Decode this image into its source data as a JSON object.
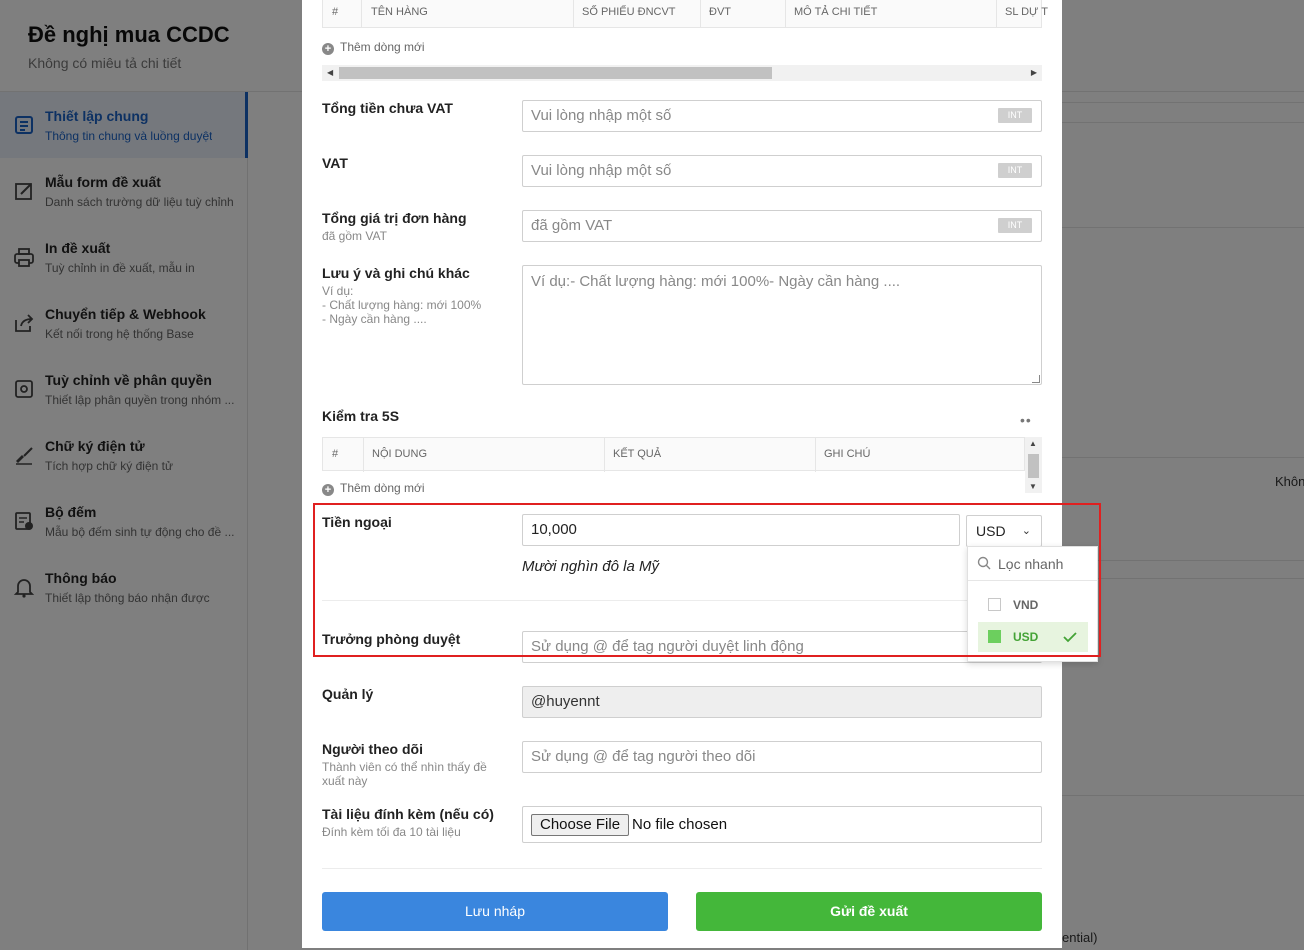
{
  "page": {
    "title": "Đề nghị mua CCDC",
    "subtitle": "Không có miêu tả chi tiết"
  },
  "sidebar": {
    "items": [
      {
        "title": "Thiết lập chung",
        "desc": "Thông tin chung và luồng duyệt",
        "icon": "document-icon",
        "active": true
      },
      {
        "title": "Mẫu form đề xuất",
        "desc": "Danh sách trường dữ liệu tuỳ chỉnh",
        "icon": "edit-icon"
      },
      {
        "title": "In đề xuất",
        "desc": "Tuỳ chỉnh in đề xuất, mẫu in",
        "icon": "printer-icon"
      },
      {
        "title": "Chuyển tiếp & Webhook",
        "desc": "Kết nối trong hệ thống Base",
        "icon": "share-icon"
      },
      {
        "title": "Tuỳ chỉnh về phân quyền",
        "desc": "Thiết lập phân quyền trong nhóm ...",
        "icon": "settings-icon"
      },
      {
        "title": "Chữ ký điện tử",
        "desc": "Tích hợp chữ ký điện tử",
        "icon": "signature-icon"
      },
      {
        "title": "Bộ đếm",
        "desc": "Mẫu bộ đếm sinh tự động cho đề ...",
        "icon": "counter-icon"
      },
      {
        "title": "Thông báo",
        "desc": "Thiết lập thông báo nhận được",
        "icon": "bell-icon"
      }
    ]
  },
  "background": {
    "right_text": "Khôn",
    "bottom_text": "ential)"
  },
  "modal": {
    "items_table": {
      "columns": [
        "#",
        "TÊN HÀNG",
        "SỐ PHIẾU ĐNCVT",
        "ĐVT",
        "MÔ TẢ CHI TIẾT",
        "SL DỰ T"
      ],
      "add_row": "Thêm dòng mới"
    },
    "subtotal": {
      "label": "Tổng tiền chưa VAT",
      "placeholder": "Vui lòng nhập một số",
      "badge": "INT"
    },
    "vat": {
      "label": "VAT",
      "placeholder": "Vui lòng nhập một số",
      "badge": "INT"
    },
    "order_total": {
      "label": "Tổng giá trị đơn hàng",
      "sublabel": "đã gồm VAT",
      "placeholder": "đã gồm VAT",
      "badge": "INT"
    },
    "notes": {
      "label": "Lưu ý và ghi chú khác",
      "sublabel": "Ví dụ:\n- Chất lượng hàng: mới 100%\n- Ngày cần hàng ....",
      "placeholder": "Ví dụ:- Chất lượng hàng: mới 100%- Ngày cần hàng ...."
    },
    "check_5s": {
      "label": "Kiểm tra 5S",
      "more": "••",
      "columns": [
        "#",
        "NỘI DUNG",
        "KẾT QUẢ",
        "GHI CHÚ"
      ],
      "add_row": "Thêm dòng mới"
    },
    "foreign_currency": {
      "label": "Tiền ngoại",
      "value": "10,000",
      "currency": "USD",
      "amount_in_words": "Mười nghìn đô la Mỹ"
    },
    "currency_dropdown": {
      "search_placeholder": "Lọc nhanh",
      "options": [
        {
          "label": "VND",
          "selected": false
        },
        {
          "label": "USD",
          "selected": true
        }
      ]
    },
    "dept_head": {
      "label": "Trưởng phòng duyệt",
      "placeholder": "Sử dụng @ để tag người duyệt linh động"
    },
    "manager": {
      "label": "Quản lý",
      "value": "@huyennt"
    },
    "followers": {
      "label": "Người theo dõi",
      "sublabel": "Thành viên có thể nhìn thấy đề\nxuất này",
      "placeholder": "Sử dụng @ để tag người theo dõi"
    },
    "attachments": {
      "label": "Tài liệu đính kèm (nếu có)",
      "sublabel": "Đính kèm tối đa 10 tài liệu",
      "button": "Choose File",
      "status": "No file chosen"
    },
    "buttons": {
      "draft": "Lưu nháp",
      "submit": "Gửi đề xuất"
    }
  },
  "colors": {
    "primary": "#3a86de",
    "success": "#44b73a",
    "highlight": "#e02020",
    "active_nav": "#1a62c7"
  }
}
